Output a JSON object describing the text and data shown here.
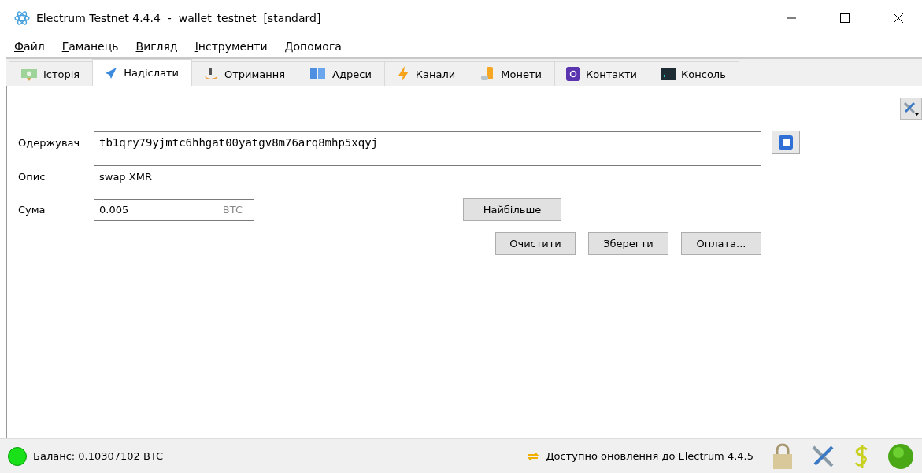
{
  "window": {
    "title": "Electrum Testnet 4.4.4  -  wallet_testnet  [standard]"
  },
  "menu": [
    "Файл",
    "Гаманець",
    "Вигляд",
    "Інструменти",
    "Допомога"
  ],
  "tabs": [
    {
      "label": "Історія",
      "selected": false,
      "kind": "history"
    },
    {
      "label": "Надіслати",
      "selected": true,
      "kind": "send"
    },
    {
      "label": "Отримання",
      "selected": false,
      "kind": "receive"
    },
    {
      "label": "Адреси",
      "selected": false,
      "kind": "addresses"
    },
    {
      "label": "Канали",
      "selected": false,
      "kind": "channels"
    },
    {
      "label": "Монети",
      "selected": false,
      "kind": "coins"
    },
    {
      "label": "Контакти",
      "selected": false,
      "kind": "contacts"
    },
    {
      "label": "Консоль",
      "selected": false,
      "kind": "console"
    }
  ],
  "form": {
    "recipient": {
      "label": "Одержувач",
      "value": "tb1qry79yjmtc6hhgat00yatgv8m76arq8mhp5xqyj"
    },
    "description": {
      "label": "Опис",
      "value": "swap XMR"
    },
    "amount": {
      "label": "Сума",
      "value": "0.005",
      "unit": "BTC"
    },
    "max_button": "Найбільше",
    "buttons": [
      "Очистити",
      "Зберегти",
      "Оплата..."
    ]
  },
  "status_bar": {
    "balance": "Баланс: 0.10307102 BTC",
    "update": "Доступно оновлення до Electrum 4.4.5"
  }
}
